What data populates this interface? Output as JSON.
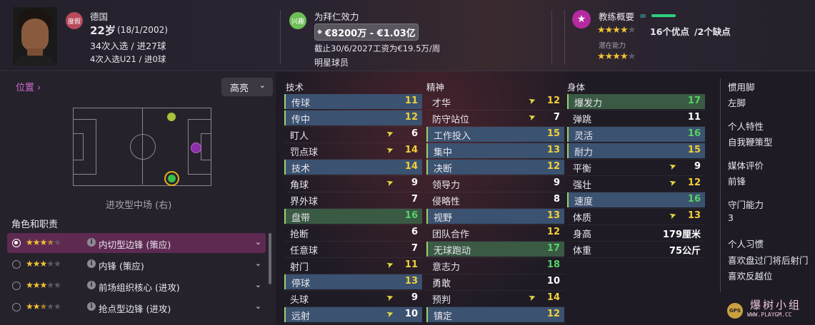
{
  "header": {
    "nation": "德国",
    "leave_tag": "度假",
    "age": "22岁",
    "dob": "(18/1/2002)",
    "caps": "34次入选 / 进27球",
    "u21": "4次入选U21 / 进0球",
    "interest_tag": "兴趣",
    "club_label": "为拜仁效力",
    "value": "€8200万 - €1.03亿",
    "contract": "截止30/6/2027工资为€19.5万/周",
    "status": "明星球员",
    "coach_title": "教练概要",
    "ability_stars_full": "★★★★",
    "ability_stars_dim": "★",
    "pros": "16个优点",
    "cons": "/2个缺点",
    "potential_label": "潜在能力",
    "potential_stars_full": "★★★★",
    "potential_stars_dim": "★"
  },
  "left": {
    "position_link": "位置 ›",
    "dropdown": "高亮",
    "position_label": "进攻型中场 (右)",
    "roles_title": "角色和职责",
    "roles": [
      {
        "stars": "★★★",
        "half": "★",
        "dim": "★",
        "name": "内切型边锋 (策应)"
      },
      {
        "stars": "★★★",
        "half": "",
        "dim": "★★",
        "name": "内锋 (策应)"
      },
      {
        "stars": "★★★",
        "half": "",
        "dim": "★★",
        "name": "前场组织核心 (进攻)"
      },
      {
        "stars": "★★",
        "half": "★",
        "dim": "★★",
        "name": "抢点型边锋 (进攻)"
      }
    ]
  },
  "technical": {
    "title": "技术",
    "rows": [
      {
        "name": "传球",
        "value": "11"
      },
      {
        "name": "传中",
        "value": "12"
      },
      {
        "name": "盯人",
        "value": "6"
      },
      {
        "name": "罚点球",
        "value": "14"
      },
      {
        "name": "技术",
        "value": "14"
      },
      {
        "name": "角球",
        "value": "9"
      },
      {
        "name": "界外球",
        "value": "7"
      },
      {
        "name": "盘带",
        "value": "16"
      },
      {
        "name": "抢断",
        "value": "6"
      },
      {
        "name": "任意球",
        "value": "7"
      },
      {
        "name": "射门",
        "value": "11"
      },
      {
        "name": "停球",
        "value": "13"
      },
      {
        "name": "头球",
        "value": "9"
      },
      {
        "name": "远射",
        "value": "10"
      }
    ]
  },
  "mental": {
    "title": "精神",
    "rows": [
      {
        "name": "才华",
        "value": "12"
      },
      {
        "name": "防守站位",
        "value": "7"
      },
      {
        "name": "工作投入",
        "value": "15"
      },
      {
        "name": "集中",
        "value": "13"
      },
      {
        "name": "决断",
        "value": "12"
      },
      {
        "name": "领导力",
        "value": "9"
      },
      {
        "name": "侵略性",
        "value": "8"
      },
      {
        "name": "视野",
        "value": "13"
      },
      {
        "name": "团队合作",
        "value": "12"
      },
      {
        "name": "无球跑动",
        "value": "17"
      },
      {
        "name": "意志力",
        "value": "18"
      },
      {
        "name": "勇敢",
        "value": "10"
      },
      {
        "name": "预判",
        "value": "14"
      },
      {
        "name": "镇定",
        "value": "12"
      }
    ]
  },
  "physical": {
    "title": "身体",
    "rows": [
      {
        "name": "爆发力",
        "value": "17"
      },
      {
        "name": "弹跳",
        "value": "11"
      },
      {
        "name": "灵活",
        "value": "16"
      },
      {
        "name": "耐力",
        "value": "15"
      },
      {
        "name": "平衡",
        "value": "9"
      },
      {
        "name": "强壮",
        "value": "12"
      },
      {
        "name": "速度",
        "value": "16"
      },
      {
        "name": "体质",
        "value": "13"
      },
      {
        "name": "身高",
        "value": "179厘米"
      },
      {
        "name": "体重",
        "value": "75公斤"
      }
    ]
  },
  "info": {
    "foot_label": "惯用脚",
    "foot_value": "左脚",
    "trait_label": "个人特性",
    "trait_value": "自我鞭策型",
    "media_label": "媒体评价",
    "media_value": "前锋",
    "gk_label": "守门能力",
    "gk_value": "3",
    "habits_label": "个人习惯",
    "habit1": "喜欢盘过门将后射门",
    "habit2": "喜欢反越位"
  },
  "watermark": {
    "logo": "GPS",
    "title": "爆树小组",
    "url": "WWW.PLAYGM.CC"
  },
  "colors": {
    "bg": "#1e1b25",
    "selected_role": "#5e2a52",
    "highlight_blue": "#3b5270",
    "highlight_green": "#3a5a44",
    "value_green": "#56d364",
    "value_yellow": "#f2d03a",
    "star": "#f1c232",
    "accent_purple": "#b52aa0"
  }
}
